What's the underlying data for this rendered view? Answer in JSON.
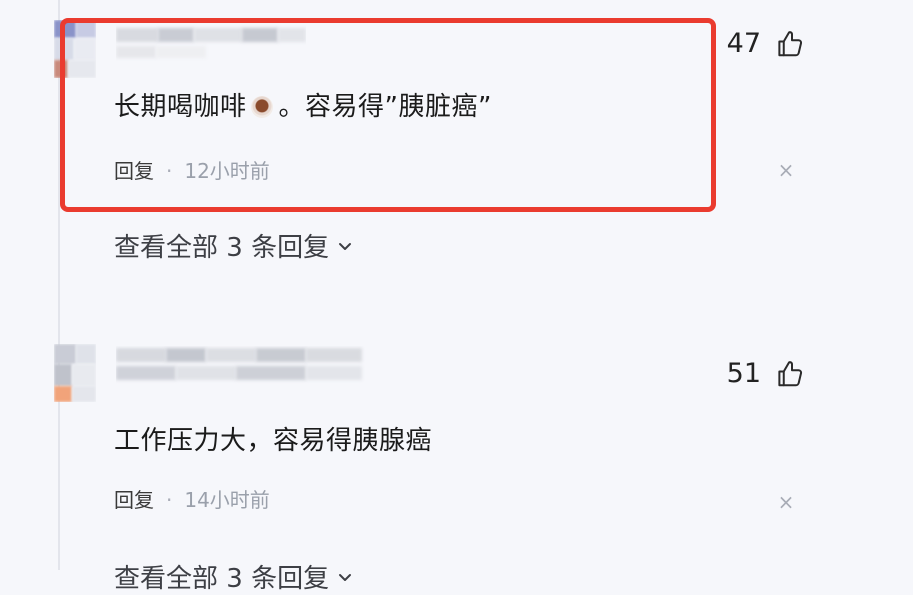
{
  "comments": [
    {
      "text_before_emoji": "长期喝咖啡",
      "emoji": "coffee-icon",
      "text_after_emoji": "。容易得”胰脏癌”",
      "reply_label": "回复",
      "separator": "·",
      "timestamp": "12小时前",
      "likes": "47",
      "view_all_replies": "查看全部 3 条回复"
    },
    {
      "text": "工作压力大，容易得胰腺癌",
      "reply_label": "回复",
      "separator": "·",
      "timestamp": "14小时前",
      "likes": "51",
      "view_all_replies": "查看全部 3 条回复"
    }
  ],
  "icons": {
    "like": "thumbs-up-icon",
    "dismiss": "close-icon",
    "expand": "chevron-down-icon"
  },
  "colors": {
    "background": "#f6f7fb",
    "highlight_border": "#ea3b2f",
    "muted_text": "#9aa0ab"
  }
}
